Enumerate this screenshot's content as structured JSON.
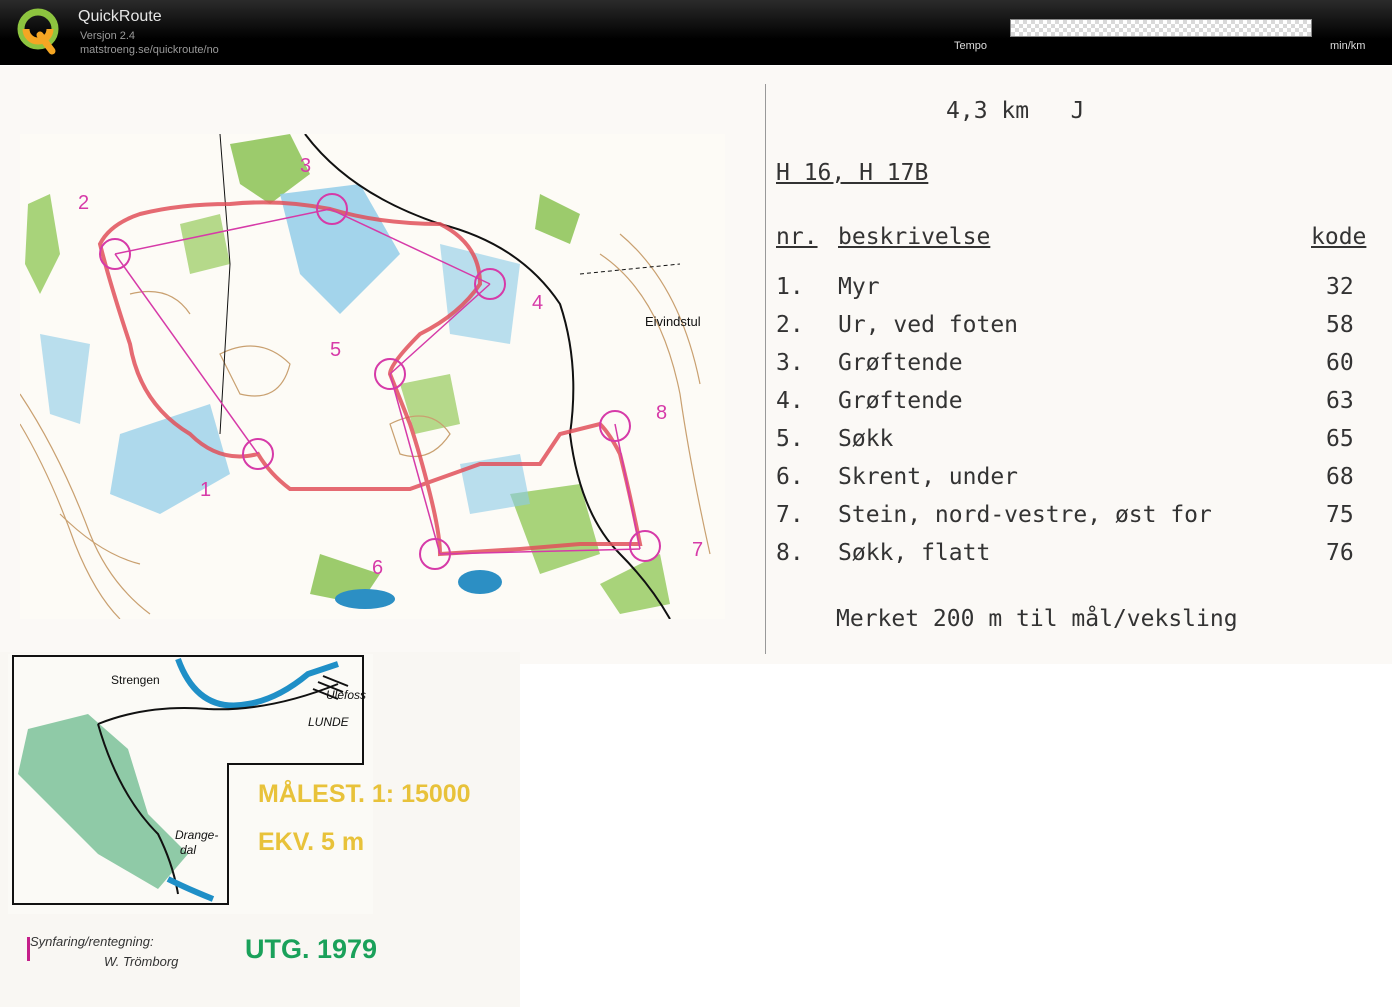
{
  "app": {
    "title": "QuickRoute",
    "version": "Versjon 2.4",
    "url": "matstroeng.se/quickroute/no",
    "tempo_label": "Tempo",
    "unit_label": "min/km"
  },
  "map": {
    "place_label": "Eivindstul",
    "controls": [
      "1",
      "2",
      "3",
      "4",
      "5",
      "6",
      "7",
      "8"
    ]
  },
  "description": {
    "distance": "4,3 km",
    "level": "J",
    "classes": "H 16, H 17B",
    "col_nr": "nr.",
    "col_desc": "beskrivelse",
    "col_code": "kode",
    "rows": [
      {
        "nr": "1.",
        "text": "Myr",
        "code": "32"
      },
      {
        "nr": "2.",
        "text": "Ur, ved foten",
        "code": "58"
      },
      {
        "nr": "3.",
        "text": "Grøftende",
        "code": "60"
      },
      {
        "nr": "4.",
        "text": "Grøftende",
        "code": "63"
      },
      {
        "nr": "5.",
        "text": "Søkk",
        "code": "65"
      },
      {
        "nr": "6.",
        "text": "Skrent, under",
        "code": "68"
      },
      {
        "nr": "7.",
        "text": "Stein, nord-vestre, øst for",
        "code": "75"
      },
      {
        "nr": "8.",
        "text": "Søkk, flatt",
        "code": "76"
      }
    ],
    "footer": "Merket 200 m til mål/veksling"
  },
  "legend": {
    "strengen": "Strengen",
    "ulefoss": "Ulefoss",
    "lunde": "LUNDE",
    "drangedal_1": "Drange-",
    "drangedal_2": "dal",
    "scale": "MÅLEST. 1: 15000",
    "equidistance": "EKV.  5 m",
    "credit_1": "Synfaring/rentegning:",
    "credit_2": "W. Trömborg",
    "edition": "UTG. 1979"
  },
  "colors": {
    "route": "#e0505a",
    "control": "#d63aa8",
    "forest": "#9ccb6c",
    "water": "#7fc7e6",
    "contour": "#c9a070"
  }
}
